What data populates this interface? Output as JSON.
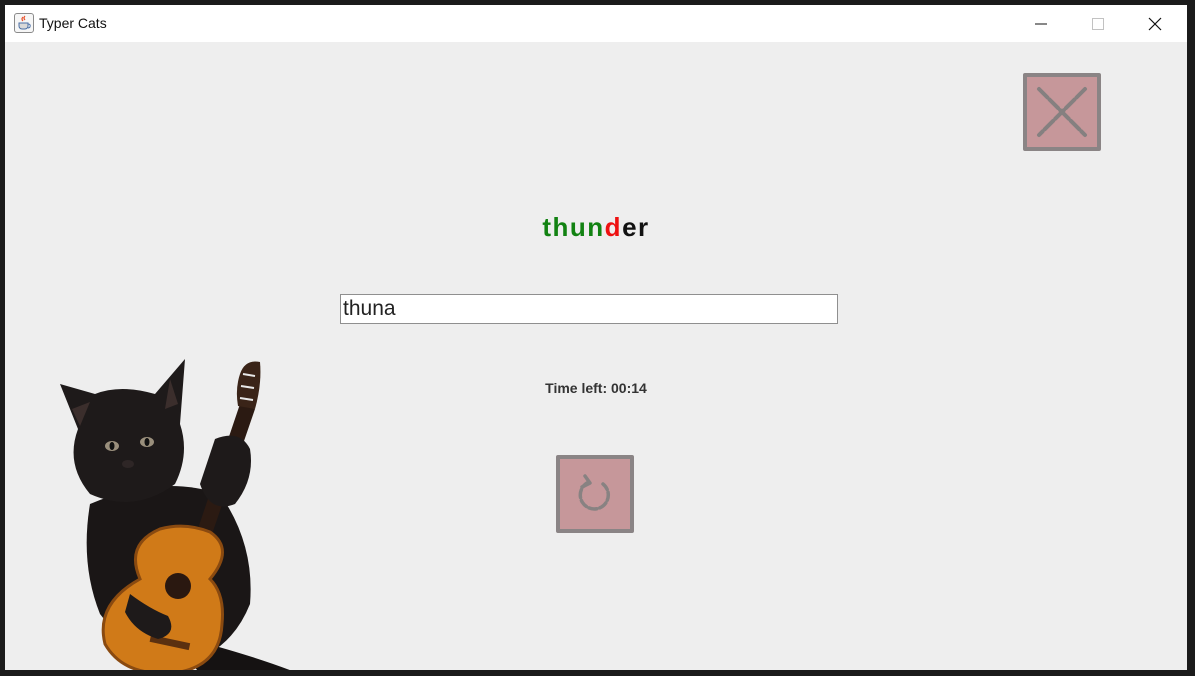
{
  "window": {
    "title": "Typer Cats",
    "app_icon": "java-cup-icon",
    "controls": {
      "minimize_icon": "minimize-icon",
      "maximize_icon": "maximize-icon",
      "close_icon": "close-icon"
    }
  },
  "game": {
    "target_word": {
      "typed_correct": "thun",
      "typed_wrong": "d",
      "remaining": "er"
    },
    "input_value": "thuna",
    "timer_text": "Time left: 00:14",
    "exit_button_icon": "x-icon",
    "restart_button_icon": "restart-icon",
    "mascot": "cat-with-guitar"
  },
  "colors": {
    "correct": "#128212",
    "wrong": "#ee1111",
    "pending": "#111111",
    "tile_fill": "#c6979a",
    "tile_border": "#8a8485"
  }
}
